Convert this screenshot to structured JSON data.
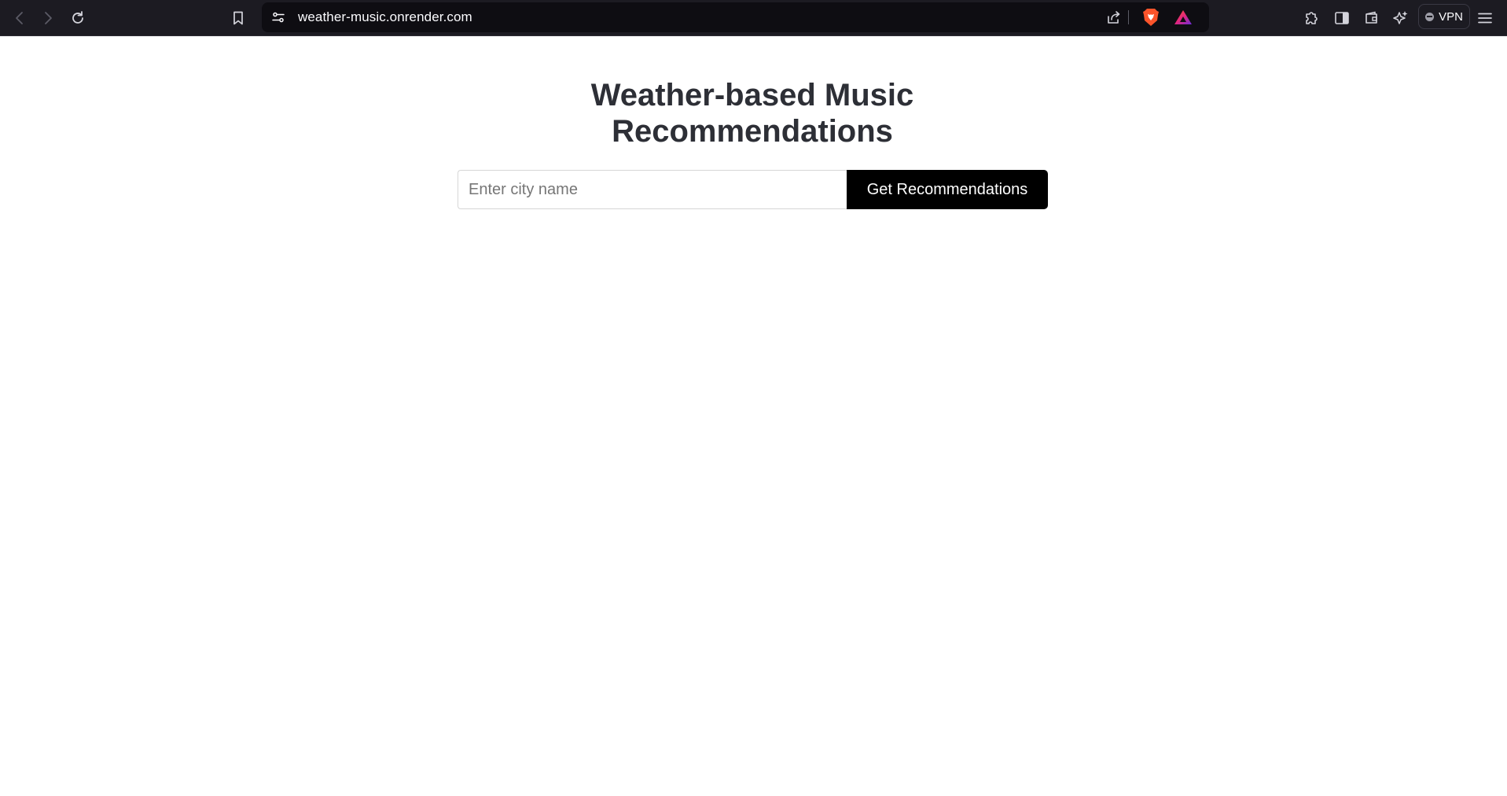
{
  "browser": {
    "url": "weather-music.onrender.com",
    "vpn_label": "VPN",
    "icons": {
      "back": "back-arrow-icon",
      "forward": "forward-arrow-icon",
      "reload": "reload-icon",
      "bookmark": "bookmark-icon",
      "site_settings": "site-settings-icon",
      "share": "share-icon",
      "brave_shields": "brave-shields-icon",
      "brave_rewards": "brave-rewards-icon",
      "extensions": "extensions-icon",
      "sidebar": "sidebar-icon",
      "wallet": "wallet-icon",
      "leo": "leo-ai-icon",
      "menu": "hamburger-menu-icon"
    },
    "colors": {
      "toolbar_bg": "#1c1b22",
      "omnibox_bg": "#0e0d12",
      "brave_orange": "#fb542b"
    }
  },
  "page": {
    "title": "Weather-based Music Recommendations",
    "city_input": {
      "value": "",
      "placeholder": "Enter city name"
    },
    "submit_label": "Get Recommendations",
    "colors": {
      "title": "#2d2f36",
      "button_bg": "#000000",
      "button_text": "#ffffff"
    }
  }
}
